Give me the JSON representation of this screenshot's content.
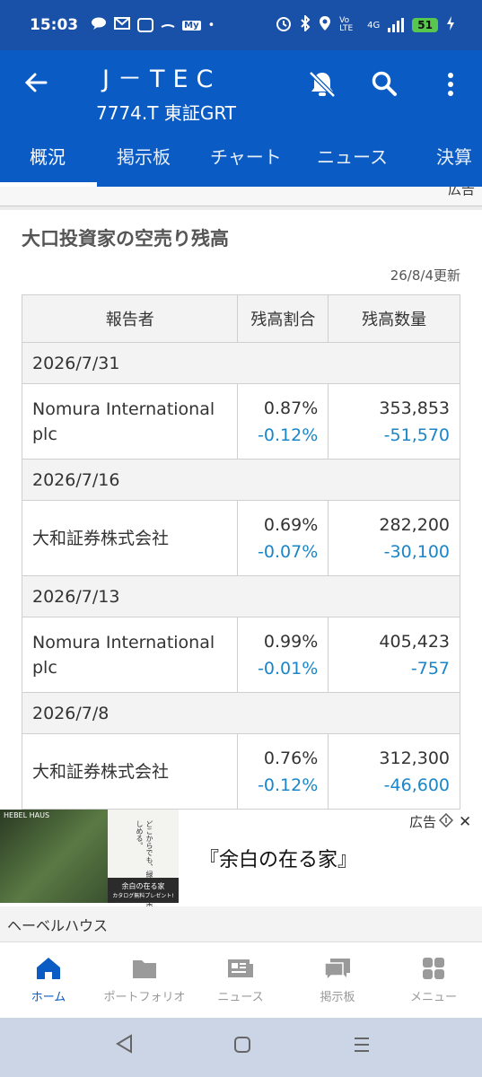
{
  "status_bar": {
    "time": "15:03",
    "volte": "Vo LTE",
    "network": "4G",
    "battery": "51",
    "left_icons": [
      "chat-icon",
      "mail-icon",
      "instagram-icon",
      "dash-icon",
      "my-badge-icon",
      "dot-icon"
    ],
    "right_icons": [
      "alarm-icon",
      "bluetooth-icon",
      "location-icon",
      "signal-icon",
      "charging-icon"
    ],
    "my_badge": "My"
  },
  "header": {
    "company": "J－TEC",
    "code": "7774.T 東証GRT",
    "icons": [
      "back-arrow-icon",
      "bell-off-icon",
      "search-icon",
      "more-vert-icon"
    ]
  },
  "tabs": [
    {
      "label": "概況",
      "active": true
    },
    {
      "label": "掲示板",
      "active": false
    },
    {
      "label": "チャート",
      "active": false
    },
    {
      "label": "ニュース",
      "active": false
    },
    {
      "label": "決算",
      "active": false
    }
  ],
  "ad_strip_label": "広告",
  "section": {
    "title": "大口投資家の空売り残高",
    "updated": "26/8/4更新"
  },
  "table": {
    "headers": [
      "報告者",
      "残高割合",
      "残高数量"
    ],
    "groups": [
      {
        "date": "2026/7/31",
        "reporter_line1": "Nomura International",
        "reporter_line2": "plc",
        "ratio": "0.87%",
        "ratio_change": "-0.12%",
        "quantity": "353,853",
        "quantity_change": "-51,570"
      },
      {
        "date": "2026/7/16",
        "reporter_line1": "大和証券株式会社",
        "reporter_line2": "",
        "ratio": "0.69%",
        "ratio_change": "-0.07%",
        "quantity": "282,200",
        "quantity_change": "-30,100"
      },
      {
        "date": "2026/7/13",
        "reporter_line1": "Nomura International",
        "reporter_line2": "plc",
        "ratio": "0.99%",
        "ratio_change": "-0.01%",
        "quantity": "405,423",
        "quantity_change": "-757"
      },
      {
        "date": "2026/7/8",
        "reporter_line1": "大和証券株式会社",
        "reporter_line2": "",
        "ratio": "0.76%",
        "ratio_change": "-0.12%",
        "quantity": "312,300",
        "quantity_change": "-46,600"
      }
    ]
  },
  "ad": {
    "brand": "HEBEL HAUS",
    "headline": "『余白の在る家』",
    "label": "広告",
    "sponsor": "ヘーベルハウス",
    "image_caption": "どこからでも、緑や空を楽しめる。",
    "image_title": "余白の在る家",
    "image_cta": "カタログ無料プレゼント!"
  },
  "bottom_nav": [
    {
      "label": "ホーム",
      "icon": "home-icon",
      "active": true
    },
    {
      "label": "ポートフォリオ",
      "icon": "folder-icon",
      "active": false
    },
    {
      "label": "ニュース",
      "icon": "news-icon",
      "active": false
    },
    {
      "label": "掲示板",
      "icon": "chat-bubbles-icon",
      "active": false
    },
    {
      "label": "メニュー",
      "icon": "menu-grid-icon",
      "active": false
    }
  ],
  "system_nav": [
    "back-triangle-icon",
    "home-square-icon",
    "recents-icon"
  ],
  "colors": {
    "brand_blue": "#0a5bc4",
    "status_bar": "#1a51a8",
    "change_blue": "#1a85c9"
  }
}
